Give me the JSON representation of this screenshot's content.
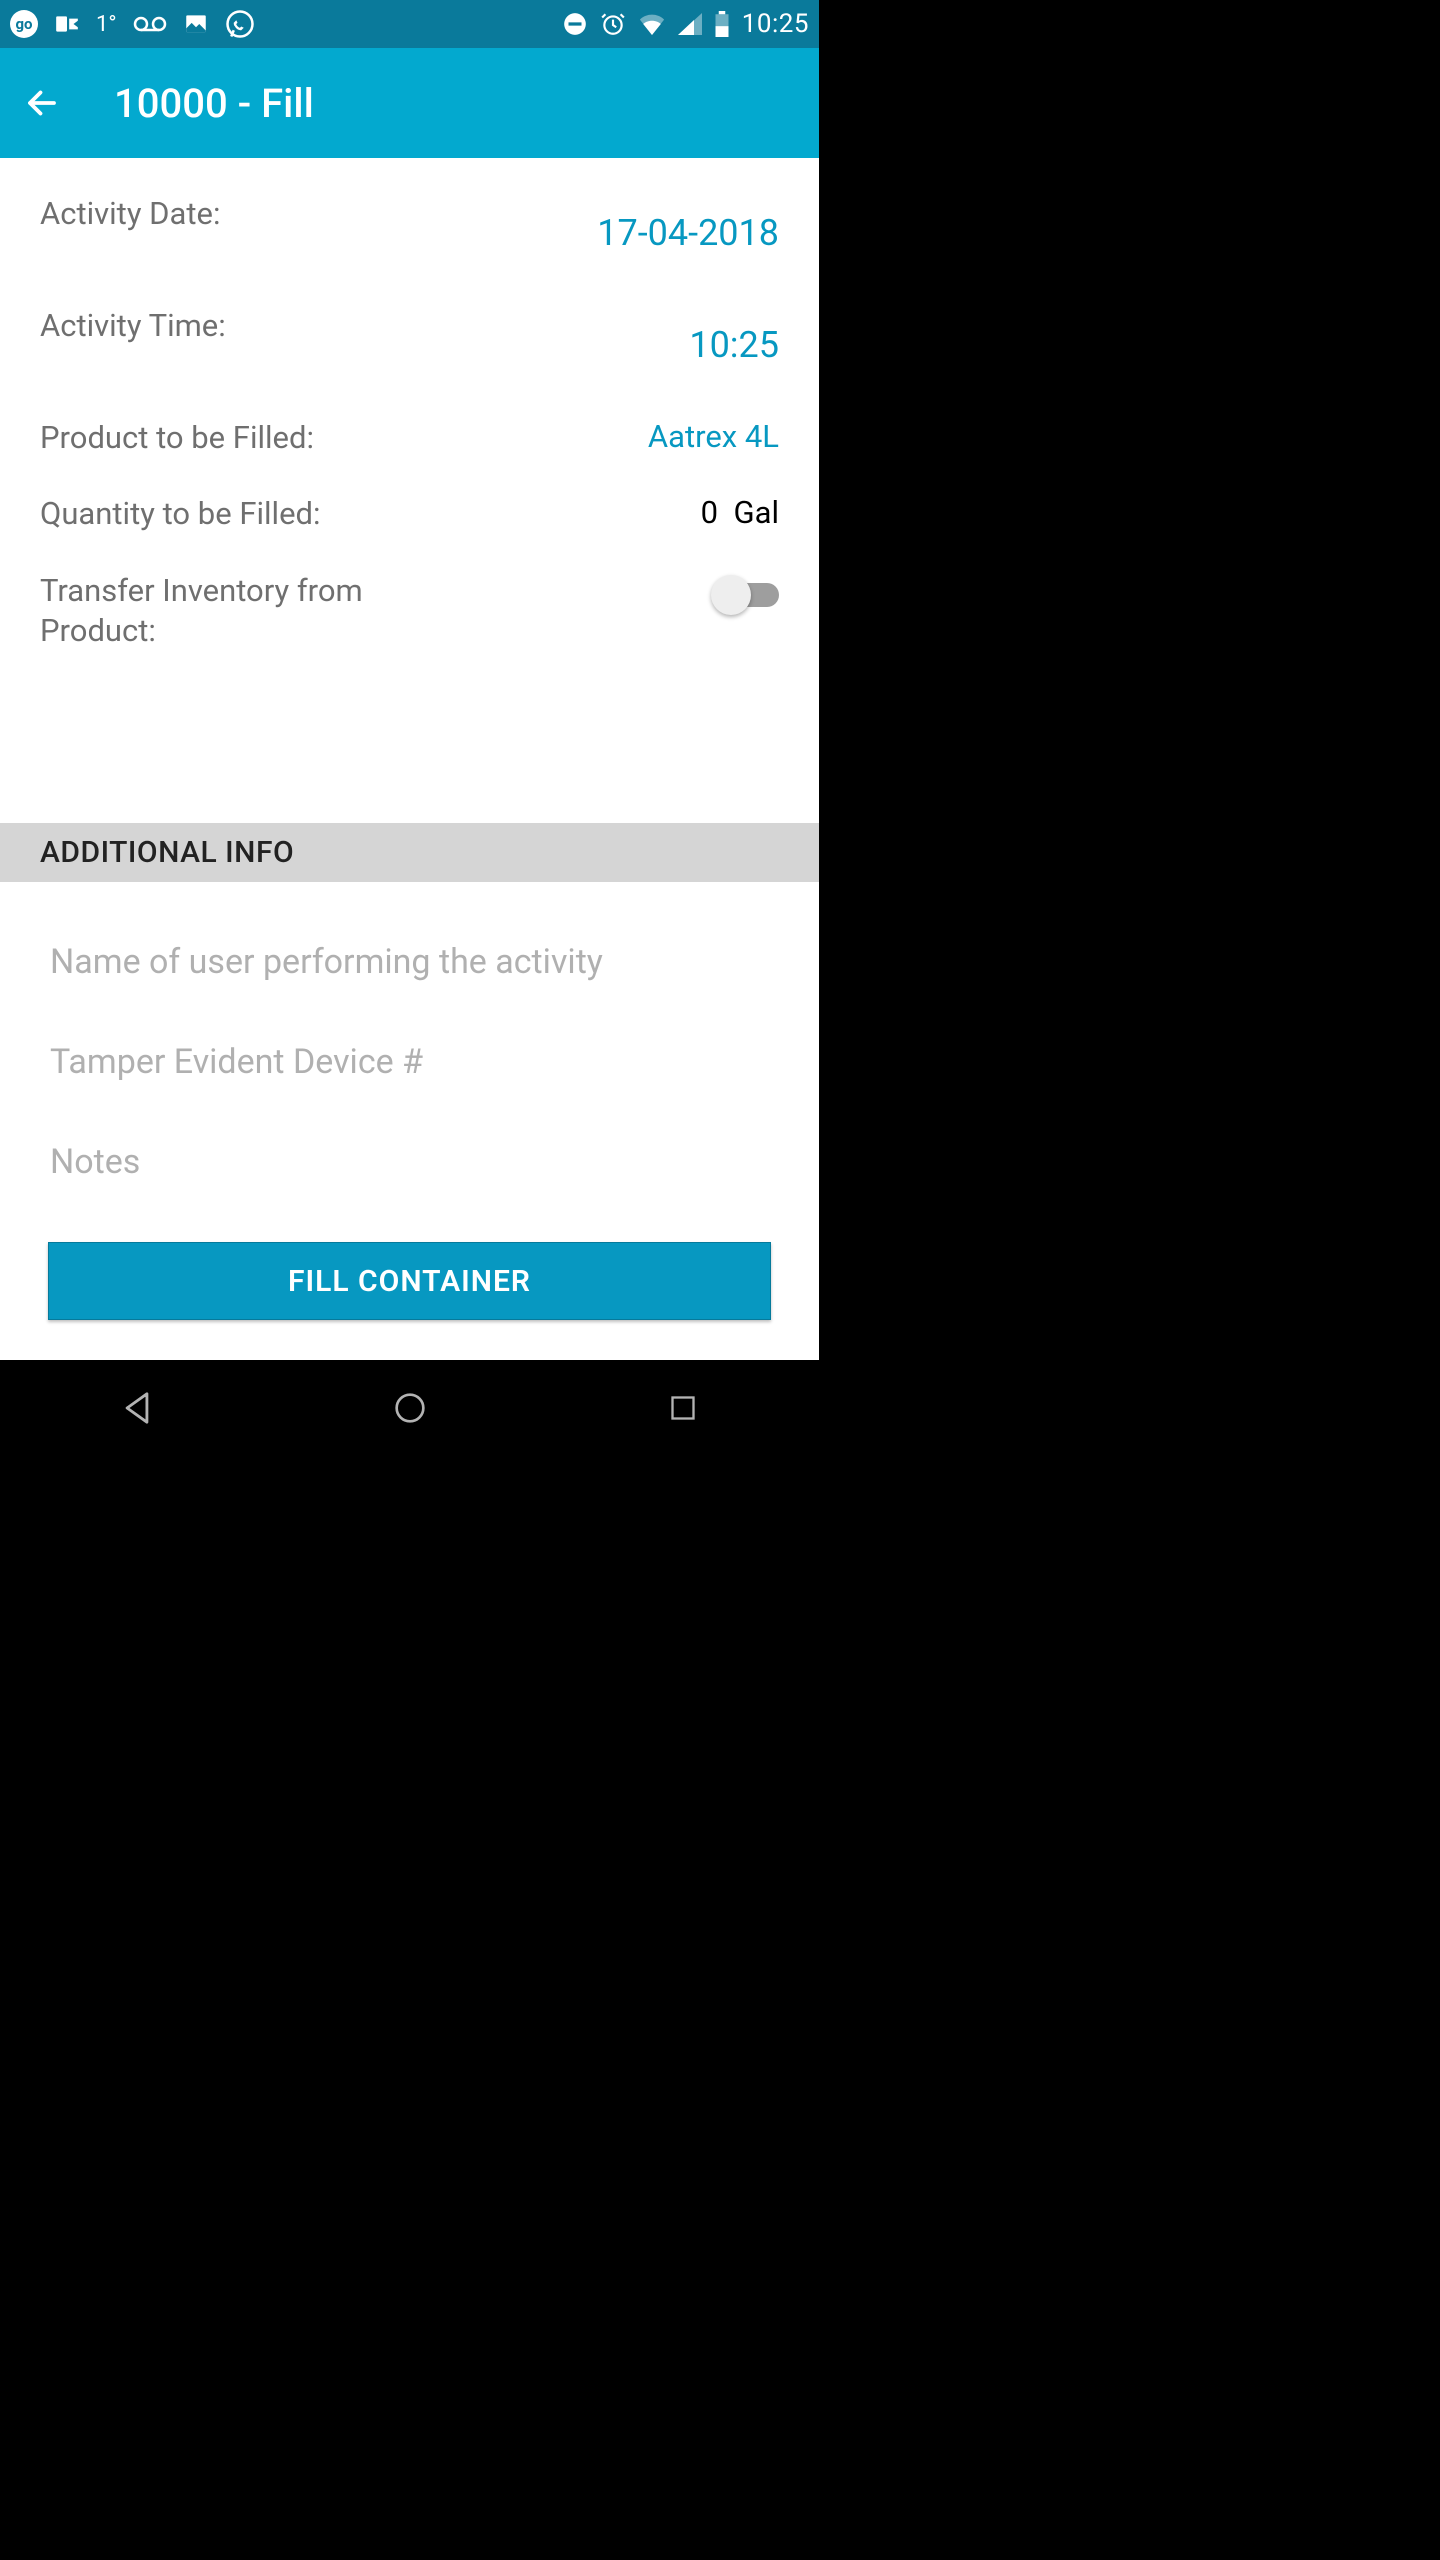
{
  "statusbar": {
    "time": "10:25",
    "temp": "1°",
    "icons": {
      "go": "go-icon",
      "outlook": "outlook-icon",
      "voicemail": "voicemail-icon",
      "picture": "picture-icon",
      "whatsapp": "whatsapp-icon",
      "dnd": "dnd-icon",
      "alarm": "alarm-icon",
      "wifi": "wifi-icon",
      "signal": "signal-icon",
      "battery": "battery-icon"
    }
  },
  "appbar": {
    "title": "10000 - Fill"
  },
  "form": {
    "activity_date_label": "Activity Date:",
    "activity_date_value": "17-04-2018",
    "activity_time_label": "Activity Time:",
    "activity_time_value": "10:25",
    "product_label": "Product to be Filled:",
    "product_value": "Aatrex 4L",
    "quantity_label": "Quantity to be Filled:",
    "quantity_value": "0",
    "quantity_unit": "Gal",
    "transfer_label": "Transfer Inventory from Product:",
    "transfer_on": false
  },
  "section": {
    "additional_info": "ADDITIONAL INFO"
  },
  "inputs": {
    "user_placeholder": "Name of user performing the activity",
    "tamper_placeholder": "Tamper Evident Device #",
    "notes_placeholder": "Notes",
    "user_value": "",
    "tamper_value": "",
    "notes_value": ""
  },
  "actions": {
    "fill_label": "FILL CONTAINER"
  }
}
